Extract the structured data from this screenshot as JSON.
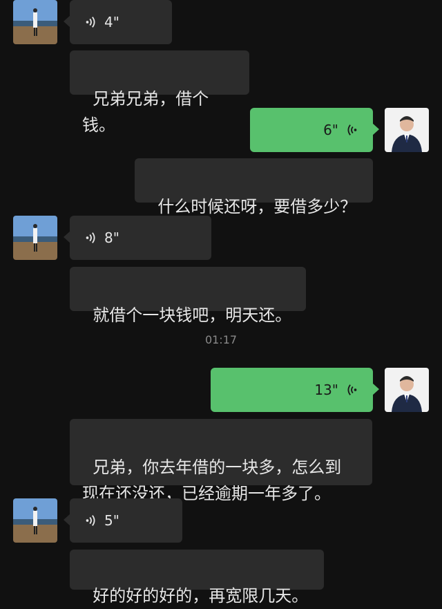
{
  "messages": [
    {
      "type": "voice",
      "side": "left",
      "duration": "4\""
    },
    {
      "type": "text",
      "side": "left",
      "text": "兄弟兄弟，借个钱。"
    },
    {
      "type": "voice",
      "side": "right",
      "duration": "6\""
    },
    {
      "type": "text",
      "side": "left",
      "text": "什么时候还呀，要借多少？"
    },
    {
      "type": "voice",
      "side": "left",
      "duration": "8\""
    },
    {
      "type": "text",
      "side": "left",
      "text": "就借个一块钱吧，明天还。"
    },
    {
      "type": "voice",
      "side": "right",
      "duration": "13\""
    },
    {
      "type": "text",
      "side": "left",
      "text": "兄弟，你去年借的一块多，怎么到\n现在还没还，已经逾期一年多了。"
    },
    {
      "type": "voice",
      "side": "left",
      "duration": "5\""
    },
    {
      "type": "text",
      "side": "left",
      "text": "好的好的好的，再宽限几天。"
    }
  ],
  "timestamp": "01:17",
  "colors": {
    "background": "#111111",
    "incoming": "#2c2c2c",
    "outgoing": "#58c16d"
  },
  "icons": {
    "voice_left": "voice-wave-icon",
    "voice_right": "voice-wave-icon"
  }
}
